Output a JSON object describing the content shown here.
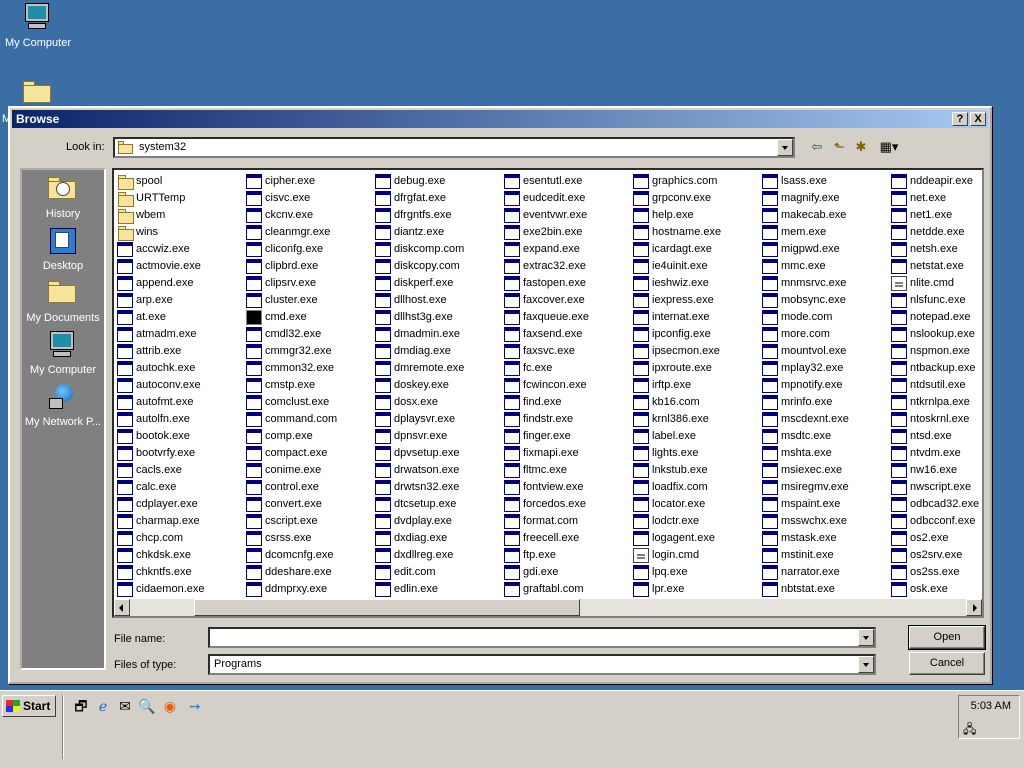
{
  "desktop": {
    "icons": [
      {
        "label": "My Computer",
        "icon": "monitor-icon"
      },
      {
        "label": "M",
        "icon": "folder-icon"
      }
    ]
  },
  "dialog": {
    "title": "Browse",
    "help_btn": "?",
    "close_btn": "X",
    "look_in_label": "Look in:",
    "look_in_value": "system32",
    "file_name_label": "File name:",
    "file_name_value": "",
    "files_of_type_label": "Files of type:",
    "files_of_type_value": "Programs",
    "open_button": "Open",
    "cancel_button": "Cancel",
    "places": [
      {
        "label": "History"
      },
      {
        "label": "Desktop"
      },
      {
        "label": "My Documents"
      },
      {
        "label": "My Computer"
      },
      {
        "label": "My Network P..."
      }
    ]
  },
  "files": {
    "columns": [
      [
        "spool",
        "URTTemp",
        "wbem",
        "wins",
        "accwiz.exe",
        "actmovie.exe",
        "append.exe",
        "arp.exe",
        "at.exe",
        "atmadm.exe",
        "attrib.exe",
        "autochk.exe",
        "autoconv.exe",
        "autofmt.exe",
        "autolfn.exe",
        "bootok.exe",
        "bootvrfy.exe",
        "cacls.exe",
        "calc.exe",
        "cdplayer.exe",
        "charmap.exe",
        "chcp.com",
        "chkdsk.exe",
        "chkntfs.exe",
        "cidaemon.exe"
      ],
      [
        "cipher.exe",
        "cisvc.exe",
        "ckcnv.exe",
        "cleanmgr.exe",
        "cliconfg.exe",
        "clipbrd.exe",
        "clipsrv.exe",
        "cluster.exe",
        "cmd.exe",
        "cmdl32.exe",
        "cmmgr32.exe",
        "cmmon32.exe",
        "cmstp.exe",
        "comclust.exe",
        "command.com",
        "comp.exe",
        "compact.exe",
        "conime.exe",
        "control.exe",
        "convert.exe",
        "cscript.exe",
        "csrss.exe",
        "dcomcnfg.exe",
        "ddeshare.exe",
        "ddmprxy.exe"
      ],
      [
        "debug.exe",
        "dfrgfat.exe",
        "dfrgntfs.exe",
        "diantz.exe",
        "diskcomp.com",
        "diskcopy.com",
        "diskperf.exe",
        "dllhost.exe",
        "dllhst3g.exe",
        "dmadmin.exe",
        "dmdiag.exe",
        "dmremote.exe",
        "doskey.exe",
        "dosx.exe",
        "dplaysvr.exe",
        "dpnsvr.exe",
        "dpvsetup.exe",
        "drwatson.exe",
        "drwtsn32.exe",
        "dtcsetup.exe",
        "dvdplay.exe",
        "dxdiag.exe",
        "dxdllreg.exe",
        "edit.com",
        "edlin.exe"
      ],
      [
        "esentutl.exe",
        "eudcedit.exe",
        "eventvwr.exe",
        "exe2bin.exe",
        "expand.exe",
        "extrac32.exe",
        "fastopen.exe",
        "faxcover.exe",
        "faxqueue.exe",
        "faxsend.exe",
        "faxsvc.exe",
        "fc.exe",
        "fcwincon.exe",
        "find.exe",
        "findstr.exe",
        "finger.exe",
        "fixmapi.exe",
        "fltmc.exe",
        "fontview.exe",
        "forcedos.exe",
        "format.com",
        "freecell.exe",
        "ftp.exe",
        "gdi.exe",
        "graftabl.com"
      ],
      [
        "graphics.com",
        "grpconv.exe",
        "help.exe",
        "hostname.exe",
        "icardagt.exe",
        "ie4uinit.exe",
        "ieshwiz.exe",
        "iexpress.exe",
        "internat.exe",
        "ipconfig.exe",
        "ipsecmon.exe",
        "ipxroute.exe",
        "irftp.exe",
        "kb16.com",
        "krnl386.exe",
        "label.exe",
        "lights.exe",
        "lnkstub.exe",
        "loadfix.com",
        "locator.exe",
        "lodctr.exe",
        "logagent.exe",
        "login.cmd",
        "lpq.exe",
        "lpr.exe"
      ],
      [
        "lsass.exe",
        "magnify.exe",
        "makecab.exe",
        "mem.exe",
        "migpwd.exe",
        "mmc.exe",
        "mnmsrvc.exe",
        "mobsync.exe",
        "mode.com",
        "more.com",
        "mountvol.exe",
        "mplay32.exe",
        "mpnotify.exe",
        "mrinfo.exe",
        "mscdexnt.exe",
        "msdtc.exe",
        "mshta.exe",
        "msiexec.exe",
        "msiregmv.exe",
        "mspaint.exe",
        "msswchx.exe",
        "mstask.exe",
        "mstinit.exe",
        "narrator.exe",
        "nbtstat.exe"
      ],
      [
        "nddeapir.exe",
        "net.exe",
        "net1.exe",
        "netdde.exe",
        "netsh.exe",
        "netstat.exe",
        "nlite.cmd",
        "nlsfunc.exe",
        "notepad.exe",
        "nslookup.exe",
        "nspmon.exe",
        "ntbackup.exe",
        "ntdsutil.exe",
        "ntkrnlpa.exe",
        "ntoskrnl.exe",
        "ntsd.exe",
        "ntvdm.exe",
        "nw16.exe",
        "nwscript.exe",
        "odbcad32.exe",
        "odbcconf.exe",
        "os2.exe",
        "os2srv.exe",
        "os2ss.exe",
        "osk.exe"
      ]
    ]
  },
  "taskbar": {
    "start_label": "Start",
    "clock": "5:03 AM"
  }
}
